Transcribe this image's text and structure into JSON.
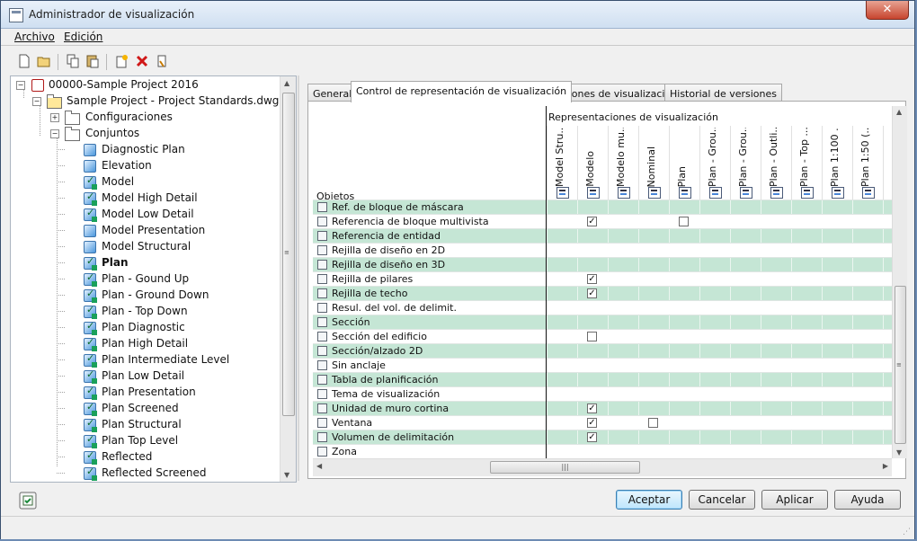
{
  "window": {
    "title": "Administrador de visualización"
  },
  "menu": [
    {
      "label": "Archivo"
    },
    {
      "label": "Edición"
    }
  ],
  "tree": {
    "project": "00000-Sample Project 2016",
    "drawing": "Sample Project - Project Standards.dwg",
    "configs": "Configuraciones",
    "sets_folder": "Conjuntos",
    "sets": [
      {
        "label": "Diagnostic Plan",
        "icon": "display-set-icon",
        "bold": false
      },
      {
        "label": "Elevation",
        "icon": "display-set-icon",
        "bold": false
      },
      {
        "label": "Model",
        "icon": "display-set-checked-icon",
        "bold": false
      },
      {
        "label": "Model High Detail",
        "icon": "display-set-checked-icon",
        "bold": false
      },
      {
        "label": "Model Low Detail",
        "icon": "display-set-checked-icon",
        "bold": false
      },
      {
        "label": "Model Presentation",
        "icon": "display-set-icon",
        "bold": false
      },
      {
        "label": "Model Structural",
        "icon": "display-set-icon",
        "bold": false
      },
      {
        "label": "Plan",
        "icon": "display-set-checked-icon",
        "bold": true
      },
      {
        "label": "Plan - Gound Up",
        "icon": "display-set-checked-icon",
        "bold": false
      },
      {
        "label": "Plan - Ground Down",
        "icon": "display-set-checked-icon",
        "bold": false
      },
      {
        "label": "Plan - Top Down",
        "icon": "display-set-checked-icon",
        "bold": false
      },
      {
        "label": "Plan Diagnostic",
        "icon": "display-set-checked-icon",
        "bold": false
      },
      {
        "label": "Plan High Detail",
        "icon": "display-set-checked-icon",
        "bold": false
      },
      {
        "label": "Plan Intermediate Level",
        "icon": "display-set-checked-icon",
        "bold": false
      },
      {
        "label": "Plan Low Detail",
        "icon": "display-set-checked-icon",
        "bold": false
      },
      {
        "label": "Plan Presentation",
        "icon": "display-set-checked-icon",
        "bold": false
      },
      {
        "label": "Plan Screened",
        "icon": "display-set-checked-icon",
        "bold": false
      },
      {
        "label": "Plan Structural",
        "icon": "display-set-checked-icon",
        "bold": false
      },
      {
        "label": "Plan Top Level",
        "icon": "display-set-checked-icon",
        "bold": false
      },
      {
        "label": "Reflected",
        "icon": "display-set-checked-icon",
        "bold": false
      },
      {
        "label": "Reflected Screened",
        "icon": "display-set-checked-icon",
        "bold": false
      }
    ]
  },
  "tabs": [
    {
      "label": "General",
      "active": false
    },
    {
      "label": "Control de representación de visualización",
      "active": true
    },
    {
      "label": "Opciones de visualización",
      "active": false
    },
    {
      "label": "Historial de versiones",
      "active": false
    }
  ],
  "grid": {
    "group_header": "Representaciones de visualización",
    "objects_header": "Objetos",
    "columns": [
      "Model Stru...",
      "Modelo",
      "Modelo mu...",
      "Nominal",
      "Plan",
      "Plan - Grou...",
      "Plan - Grou...",
      "Plan - Outli...",
      "Plan - Top ...",
      "Plan 1:100 ...",
      "Plan 1:50 (...",
      "P"
    ],
    "rows": [
      {
        "label": "Ref. de bloque de máscara",
        "checks": []
      },
      {
        "label": "Referencia de bloque multivista",
        "checks": [
          {
            "col": 1,
            "on": true
          },
          {
            "col": 4,
            "on": false
          }
        ]
      },
      {
        "label": "Referencia de entidad",
        "checks": []
      },
      {
        "label": "Rejilla de diseño en 2D",
        "checks": []
      },
      {
        "label": "Rejilla de diseño en 3D",
        "checks": []
      },
      {
        "label": "Rejilla de pilares",
        "checks": [
          {
            "col": 1,
            "on": true
          }
        ]
      },
      {
        "label": "Rejilla de techo",
        "checks": [
          {
            "col": 1,
            "on": true
          }
        ]
      },
      {
        "label": "Resul. del vol. de delimit.",
        "checks": []
      },
      {
        "label": "Sección",
        "checks": []
      },
      {
        "label": "Sección del edificio",
        "checks": [
          {
            "col": 1,
            "on": false
          }
        ]
      },
      {
        "label": "Sección/alzado 2D",
        "checks": []
      },
      {
        "label": "Sin anclaje",
        "checks": []
      },
      {
        "label": "Tabla de planificación",
        "checks": []
      },
      {
        "label": "Tema de visualización",
        "checks": []
      },
      {
        "label": "Unidad de muro cortina",
        "checks": [
          {
            "col": 1,
            "on": true
          }
        ]
      },
      {
        "label": "Ventana",
        "checks": [
          {
            "col": 1,
            "on": true
          },
          {
            "col": 3,
            "on": false
          }
        ]
      },
      {
        "label": "Volumen de delimitación",
        "checks": [
          {
            "col": 1,
            "on": true
          }
        ]
      },
      {
        "label": "Zona",
        "checks": []
      }
    ]
  },
  "buttons": {
    "ok": "Aceptar",
    "cancel": "Cancelar",
    "apply": "Aplicar",
    "help": "Ayuda"
  },
  "colors": {
    "row_highlight": "#c5e6d5",
    "default_button": "#bee6fd",
    "close_button": "#c7452f"
  }
}
